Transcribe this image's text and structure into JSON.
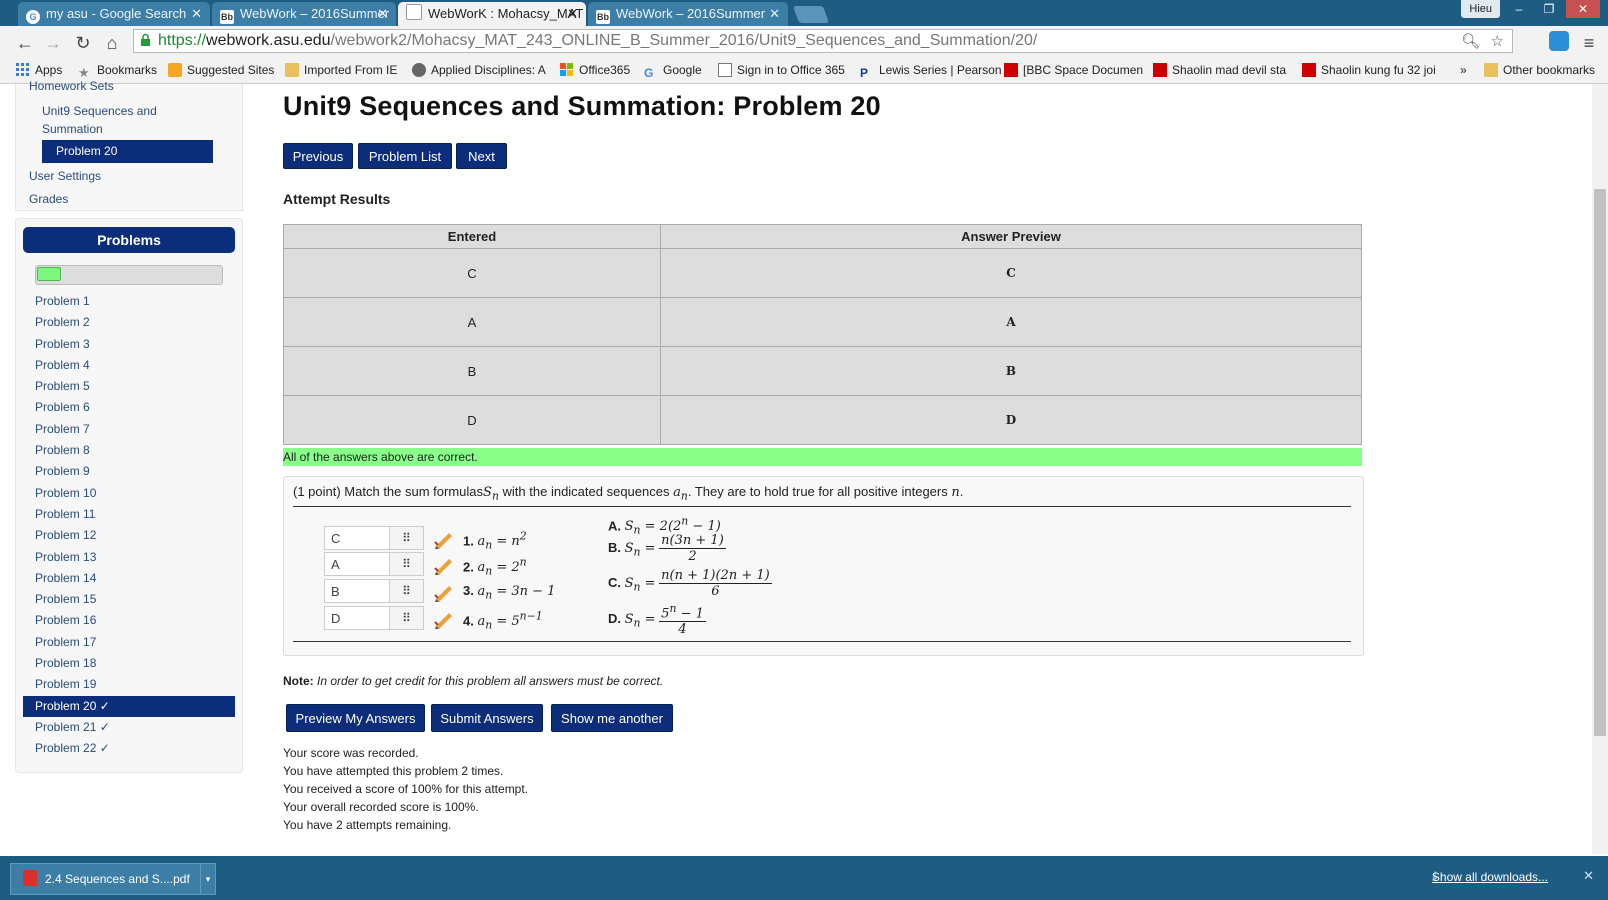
{
  "browser": {
    "tabs": [
      {
        "title": "my asu - Google Search",
        "favicon": "google-icon",
        "active": false
      },
      {
        "title": "WebWork – 2016Summer",
        "favicon": "blackboard-icon",
        "active": false
      },
      {
        "title": "WebWorK : Mohacsy_MAT",
        "favicon": "page-icon",
        "active": true
      },
      {
        "title": "WebWork – 2016Summer",
        "favicon": "blackboard-icon",
        "active": false
      }
    ],
    "user": "Hieu",
    "url_scheme": "https://",
    "url_host": "webwork.asu.edu",
    "url_path": "/webwork2/Mohacsy_MAT_243_ONLINE_B_Summer_2016/Unit9_Sequences_and_Summation/20/",
    "bookmarks": [
      {
        "label": "Apps",
        "icon": "apps-grid-icon"
      },
      {
        "label": "Bookmarks",
        "icon": "star-icon"
      },
      {
        "label": "Suggested Sites",
        "icon": "suggested-sites-icon"
      },
      {
        "label": "Imported From IE",
        "icon": "folder-icon"
      },
      {
        "label": "Applied Disciplines: A",
        "icon": "site-icon"
      },
      {
        "label": "Office365",
        "icon": "office-icon"
      },
      {
        "label": "Google",
        "icon": "google-icon"
      },
      {
        "label": "Sign in to Office 365",
        "icon": "page-icon"
      },
      {
        "label": "Lewis Series | Pearson",
        "icon": "pearson-icon"
      },
      {
        "label": "[BBC Space Documen",
        "icon": "youtube-icon"
      },
      {
        "label": "Shaolin mad devil sta",
        "icon": "youtube-icon"
      },
      {
        "label": "Shaolin kung fu 32 joi",
        "icon": "youtube-icon"
      },
      {
        "label": "»",
        "icon": ""
      },
      {
        "label": "Other bookmarks",
        "icon": "folder-icon"
      }
    ]
  },
  "sidebar": {
    "homework_sets": "Homework Sets",
    "set_name": "Unit9 Sequences and Summation",
    "current_problem": "Problem 20",
    "user_settings": "User Settings",
    "grades": "Grades",
    "problems_header": "Problems",
    "progress_fraction": 0.13,
    "problems": [
      "Problem 1",
      "Problem 2",
      "Problem 3",
      "Problem 4",
      "Problem 5",
      "Problem 6",
      "Problem 7",
      "Problem 8",
      "Problem 9",
      "Problem 10",
      "Problem 11",
      "Problem 12",
      "Problem 13",
      "Problem 14",
      "Problem 15",
      "Problem 16",
      "Problem 17",
      "Problem 18",
      "Problem 19",
      "Problem 20 ✓",
      "Problem 21 ✓",
      "Problem 22 ✓"
    ],
    "active_index": 19
  },
  "main": {
    "title": "Unit9 Sequences and Summation: Problem 20",
    "nav": {
      "previous": "Previous",
      "problem_list": "Problem List",
      "next": "Next"
    },
    "attempt_results_title": "Attempt Results",
    "results_headers": [
      "Entered",
      "Answer Preview"
    ],
    "results_rows": [
      [
        "C",
        "C"
      ],
      [
        "A",
        "A"
      ],
      [
        "B",
        "B"
      ],
      [
        "D",
        "D"
      ]
    ],
    "correct_message": "All of the answers above are correct.",
    "problem": {
      "intro_prefix": "(1 point) Match the sum formulas",
      "intro_mid": " with the indicated sequences ",
      "intro_suffix": ". They are to hold true for all positive integers ",
      "answers": [
        "C",
        "A",
        "B",
        "D"
      ],
      "questions": [
        "1.",
        "2.",
        "3.",
        "4."
      ],
      "options": [
        "A.",
        "B.",
        "C.",
        "D."
      ]
    },
    "note_label": "Note:",
    "note_text": "In order to get credit for this problem all answers must be correct.",
    "buttons": {
      "preview": "Preview My Answers",
      "submit": "Submit Answers",
      "another": "Show me another"
    },
    "status_lines": [
      "Your score was recorded.",
      "You have attempted this problem 2 times.",
      "You received a score of 100% for this attempt.",
      "Your overall recorded score is 100%.",
      "You have 2 attempts remaining."
    ]
  },
  "downloads": {
    "file": "2.4 Sequences and S....pdf",
    "show_all": "Show all downloads..."
  },
  "colors": {
    "accent": "#0c2e7a",
    "correct": "#88ff88",
    "chrome": "#1e5c82"
  }
}
